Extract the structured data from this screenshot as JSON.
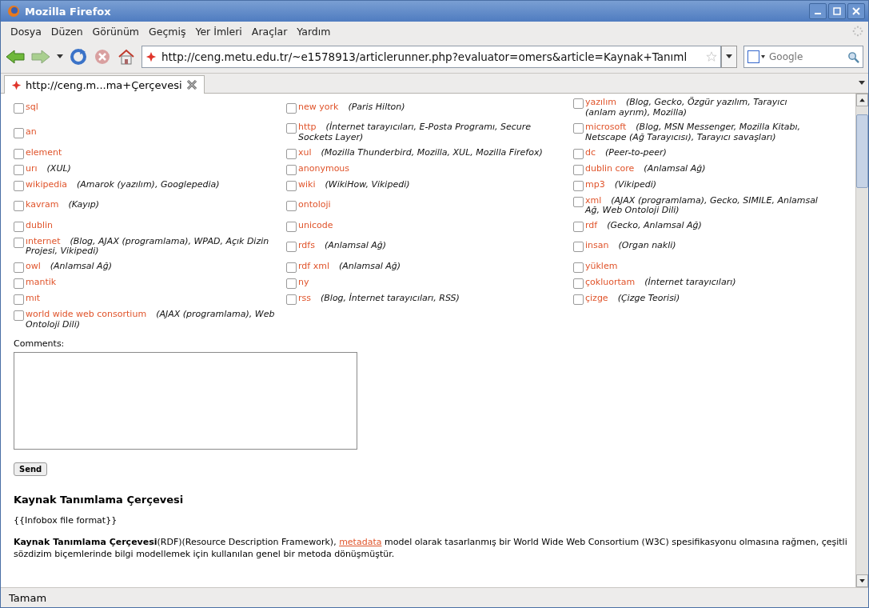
{
  "window": {
    "title": "Mozilla Firefox"
  },
  "menu": [
    "Dosya",
    "Düzen",
    "Görünüm",
    "Geçmiş",
    "Yer İmleri",
    "Araçlar",
    "Yardım"
  ],
  "address_bar": {
    "value": "http://ceng.metu.edu.tr/~e1578913/articlerunner.php?evaluator=omers&article=Kaynak+Tanıml"
  },
  "search": {
    "placeholder": "Google"
  },
  "tabs": [
    {
      "label": "http://ceng.m...ma+Çerçevesi",
      "selected": true
    }
  ],
  "tag_rows": [
    [
      {
        "term": "sql",
        "checked": false
      },
      {
        "term": "new york",
        "related": "(Paris Hilton)",
        "checked": false
      },
      {
        "term": "yazılım",
        "related": "(Blog, Gecko, Özgür yazılım, Tarayıcı (anlam ayrım), Mozilla)",
        "checked": false
      }
    ],
    [
      {
        "term": "an",
        "checked": false
      },
      {
        "term": "http",
        "related": "(İnternet tarayıcıları, E-Posta Programı, Secure Sockets Layer)",
        "checked": false
      },
      {
        "term": "microsoft",
        "related": "(Blog, MSN Messenger, Mozilla Kitabı, Netscape (Ağ Tarayıcısı), Tarayıcı savaşları)",
        "checked": false
      }
    ],
    [
      {
        "term": "element",
        "checked": false
      },
      {
        "term": "xul",
        "related": "(Mozilla Thunderbird, Mozilla, XUL, Mozilla Firefox)",
        "checked": false
      },
      {
        "term": "dc",
        "related": "(Peer-to-peer)",
        "checked": false
      }
    ],
    [
      {
        "term": "urı",
        "related": "(XUL)",
        "checked": false
      },
      {
        "term": "anonymous",
        "checked": false
      },
      {
        "term": "dublin core",
        "related": "(Anlamsal Ağ)",
        "checked": false
      }
    ],
    [
      {
        "term": "wikipedia",
        "related": "(Amarok (yazılım), Googlepedia)",
        "checked": false
      },
      {
        "term": "wiki",
        "related": "(WikiHow, Vikipedi)",
        "checked": false
      },
      {
        "term": "mp3",
        "related": "(Vikipedi)",
        "checked": false
      }
    ],
    [
      {
        "term": "kavram",
        "related": "(Kayıp)",
        "checked": false
      },
      {
        "term": "ontoloji",
        "checked": false
      },
      {
        "term": "xml",
        "related": "(AJAX (programlama), Gecko, SIMILE, Anlamsal Ağ, Web Ontoloji Dili)",
        "checked": false
      }
    ],
    [
      {
        "term": "dublin",
        "checked": false
      },
      {
        "term": "unicode",
        "checked": false
      },
      {
        "term": "rdf",
        "related": "(Gecko, Anlamsal Ağ)",
        "checked": false
      }
    ],
    [
      {
        "term": "ınternet",
        "related": "(Blog, AJAX (programlama), WPAD, Açık Dizin Projesi, Vikipedi)",
        "checked": false
      },
      {
        "term": "rdfs",
        "related": "(Anlamsal Ağ)",
        "checked": false
      },
      {
        "term": "insan",
        "related": "(Organ nakli)",
        "checked": false
      }
    ],
    [
      {
        "term": "owl",
        "related": "(Anlamsal Ağ)",
        "checked": false
      },
      {
        "term": "rdf xml",
        "related": "(Anlamsal Ağ)",
        "checked": false
      },
      {
        "term": "yüklem",
        "checked": false
      }
    ],
    [
      {
        "term": "mantik",
        "checked": false
      },
      {
        "term": "ny",
        "checked": false
      },
      {
        "term": "çokluortam",
        "related": "(İnternet tarayıcıları)",
        "checked": false
      }
    ],
    [
      {
        "term": "mıt",
        "checked": false
      },
      {
        "term": "rss",
        "related": "(Blog, İnternet tarayıcıları, RSS)",
        "checked": false
      },
      {
        "term": "çizge",
        "related": "(Çizge Teorisi)",
        "checked": false
      }
    ],
    [
      {
        "term": "world wide web consortium",
        "related": "(AJAX (programlama), Web Ontoloji Dili)",
        "checked": false
      }
    ]
  ],
  "comments_label": "Comments:",
  "send_button": "Send",
  "article": {
    "heading": "Kaynak Tanımlama Çerçevesi",
    "template": "{{Infobox file format}}",
    "paragraph_before": "**Kaynak Tanımlama Çerçevesi**(RDF)(Resource Description Framework), ",
    "link": "metadata",
    "paragraph_after": " model olarak tasarlanmış bir World Wide Web Consortium (W3C) spesifikasyonu olmasına rağmen, çeşitli sözdizim biçemlerinde bilgi modellemek için kullanılan genel bir metoda dönüşmüştür."
  },
  "status_bar": "Tamam"
}
